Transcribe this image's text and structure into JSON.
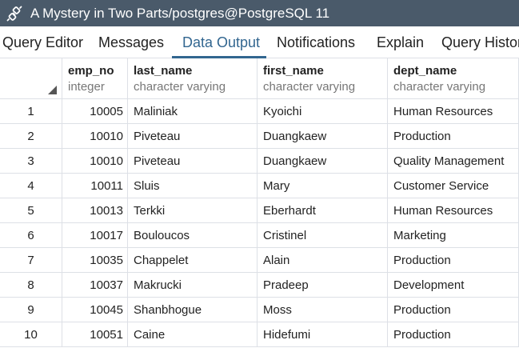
{
  "window": {
    "title": "A Mystery in Two Parts/postgres@PostgreSQL 11",
    "icon": "connection-plug-icon"
  },
  "tabs": [
    {
      "label": "Query Editor",
      "active": false
    },
    {
      "label": "Messages",
      "active": false
    },
    {
      "label": "Data Output",
      "active": true
    },
    {
      "label": "Notifications",
      "active": false
    },
    {
      "label": "Explain",
      "active": false
    },
    {
      "label": "Query Histor",
      "active": false
    }
  ],
  "grid": {
    "columns": [
      {
        "name": "emp_no",
        "type": "integer"
      },
      {
        "name": "last_name",
        "type": "character varying"
      },
      {
        "name": "first_name",
        "type": "character varying"
      },
      {
        "name": "dept_name",
        "type": "character varying"
      }
    ],
    "rows": [
      {
        "num": "1",
        "emp_no": "10005",
        "last_name": "Maliniak",
        "first_name": "Kyoichi",
        "dept_name": "Human Resources"
      },
      {
        "num": "2",
        "emp_no": "10010",
        "last_name": "Piveteau",
        "first_name": "Duangkaew",
        "dept_name": "Production"
      },
      {
        "num": "3",
        "emp_no": "10010",
        "last_name": "Piveteau",
        "first_name": "Duangkaew",
        "dept_name": "Quality Management"
      },
      {
        "num": "4",
        "emp_no": "10011",
        "last_name": "Sluis",
        "first_name": "Mary",
        "dept_name": "Customer Service"
      },
      {
        "num": "5",
        "emp_no": "10013",
        "last_name": "Terkki",
        "first_name": "Eberhardt",
        "dept_name": "Human Resources"
      },
      {
        "num": "6",
        "emp_no": "10017",
        "last_name": "Bouloucos",
        "first_name": "Cristinel",
        "dept_name": "Marketing"
      },
      {
        "num": "7",
        "emp_no": "10035",
        "last_name": "Chappelet",
        "first_name": "Alain",
        "dept_name": "Production"
      },
      {
        "num": "8",
        "emp_no": "10037",
        "last_name": "Makrucki",
        "first_name": "Pradeep",
        "dept_name": "Development"
      },
      {
        "num": "9",
        "emp_no": "10045",
        "last_name": "Shanbhogue",
        "first_name": "Moss",
        "dept_name": "Production"
      },
      {
        "num": "10",
        "emp_no": "10051",
        "last_name": "Caine",
        "first_name": "Hidefumi",
        "dept_name": "Production"
      }
    ]
  },
  "colors": {
    "titlebar_bg": "#4a5a6a",
    "active_tab": "#326690",
    "grid_border": "#dde0e6"
  }
}
